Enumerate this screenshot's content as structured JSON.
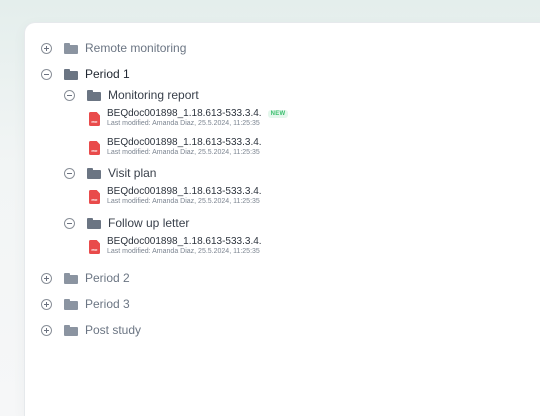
{
  "tree": {
    "remote_monitoring": {
      "label": "Remote monitoring"
    },
    "period1": {
      "label": "Period 1",
      "monitoring_report": {
        "label": "Monitoring report",
        "files": [
          {
            "name": "BEQdoc001898_1.18.613-533.3.4.",
            "meta": "Last modified: Amanda Diaz, 25.5.2024, 11:25:35",
            "badge": "NEW"
          },
          {
            "name": "BEQdoc001898_1.18.613-533.3.4.",
            "meta": "Last modified: Amanda Diaz, 25.5.2024, 11:25:35"
          }
        ]
      },
      "visit_plan": {
        "label": "Visit plan",
        "files": [
          {
            "name": "BEQdoc001898_1.18.613-533.3.4.",
            "meta": "Last modified: Amanda Diaz, 25.5.2024, 11:25:35"
          }
        ]
      },
      "follow_up_letter": {
        "label": "Follow up letter",
        "files": [
          {
            "name": "BEQdoc001898_1.18.613-533.3.4.",
            "meta": "Last modified: Amanda Diaz, 25.5.2024, 11:25:35"
          }
        ]
      }
    },
    "period2": {
      "label": "Period 2"
    },
    "period3": {
      "label": "Period 3"
    },
    "post_study": {
      "label": "Post study"
    }
  },
  "icons": {
    "toggle_expand": "plus-circle-icon",
    "toggle_collapse": "minus-circle-icon",
    "folder": "folder-icon",
    "file": "pdf-file-icon"
  },
  "colors": {
    "pdf": "#e94b4b",
    "new_badge": "#3bbf6e"
  }
}
